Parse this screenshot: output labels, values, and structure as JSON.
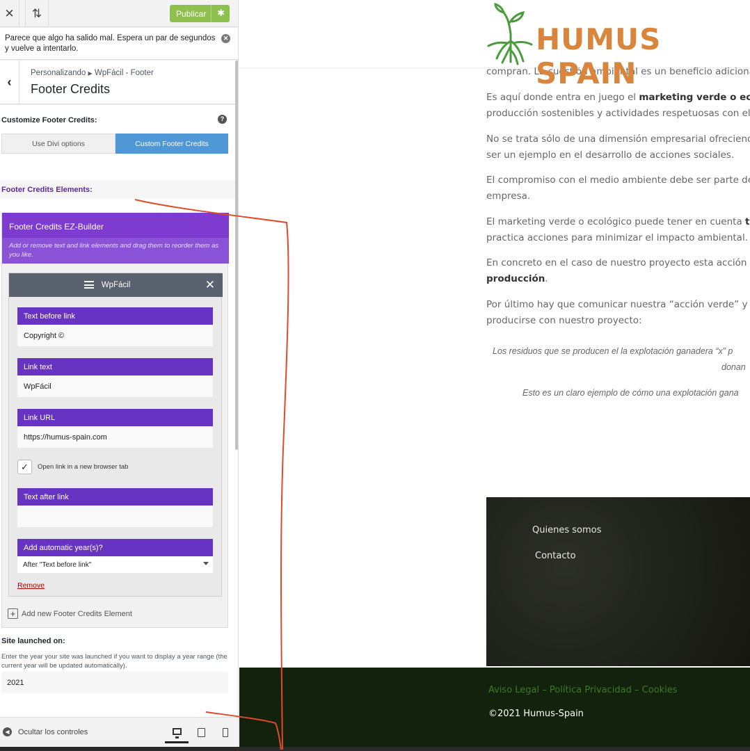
{
  "topbar": {
    "close_icon": "close-icon",
    "sort_icon": "sort-arrows-icon",
    "close_glyph": "✕",
    "sort_glyph": "⇅",
    "publish_label": "Publicar",
    "publish_color": "#8dc04d"
  },
  "notice": {
    "text": "Parece que algo ha salido mal. Espera un par de segundos y vuelve a intentarlo."
  },
  "section": {
    "breadcrumb_prefix": "Personalizando",
    "breadcrumb_current": "WpFácil - Footer",
    "title": "Footer Credits"
  },
  "customize": {
    "label": "Customize Footer Credits:",
    "options": [
      "Use Divi options",
      "Custom Footer Credits"
    ],
    "selected": "Custom Footer Credits",
    "accent": "#4f97d7"
  },
  "elements": {
    "label": "Footer Credits Elements:",
    "builder_title": "Footer Credits EZ-Builder",
    "builder_hint": "Add or remove text and link elements and drag them to reorder them as you like.",
    "card_title": "WpFácil",
    "fields": {
      "text_before_label": "Text before link",
      "text_before_value": "Copyright ©",
      "link_text_label": "Link text",
      "link_text_value": "WpFácil",
      "link_url_label": "Link URL",
      "link_url_value": "https://humus-spain.com",
      "new_tab_label": "Open link in a new browser tab",
      "new_tab_checked": true,
      "text_after_label": "Text after link",
      "text_after_value": "",
      "year_label": "Add automatic year(s)?",
      "year_value": "After \"Text before link\""
    },
    "remove_label": "Remove",
    "add_new_label": "Add new Footer Credits Element"
  },
  "launched": {
    "label": "Site launched on:",
    "description": "Enter the year your site was launched if you want to display a year range (the current year will be updated automatically).",
    "value": "2021"
  },
  "footer_controls": {
    "hide_label": "Ocultar los controles",
    "devices": [
      "desktop-icon",
      "tablet-icon",
      "mobile-icon"
    ],
    "active_device": "desktop-icon"
  },
  "preview": {
    "logo_text": "HUMUS SPAIN",
    "logo_color": "#d9853b",
    "paragraphs": [
      {
        "text": "compran. La cuestión ambiental es un beneficio adicional o v"
      },
      {
        "pre": "Es aquí donde entra en juego el ",
        "bold": "marketing verde o ecológi",
        "post": ""
      },
      {
        "text": "producción sostenibles y actividades respetuosas con el med"
      },
      {
        "text": "No se trata sólo de una dimensión empresarial ofreciendo p"
      },
      {
        "text": "ser un ejemplo en el desarrollo de acciones sociales."
      },
      {
        "text": "El compromiso con el medio ambiente debe ser parte de la m"
      },
      {
        "text": "empresa."
      },
      {
        "pre": "El marketing verde o ecológico puede tener en cuenta ",
        "bold": "todo",
        "post": ""
      },
      {
        "text": "practica acciones para minimizar el impacto ambiental."
      },
      {
        "text": "En concreto en el caso de nuestro proyecto esta acción sería"
      },
      {
        "pre": "",
        "bold": "producción",
        "post": "."
      },
      {
        "text": "Por último hay que comunicar nuestra “acción verde” y apor"
      },
      {
        "text": "producirse con nuestro proyecto:"
      }
    ],
    "quotes": [
      "Los residuos que se producen el la explotación ganadera “x” p",
      "donan",
      "Esto es un claro ejemplo de cómo una explotación gana"
    ],
    "footer_links": [
      "Quienes somos",
      "Contacto"
    ],
    "legal_links": "Aviso Legal – Política Privacidad – Cookies",
    "legal_color": "#3f7a26",
    "copyright": "©2021 Humus-Spain"
  }
}
